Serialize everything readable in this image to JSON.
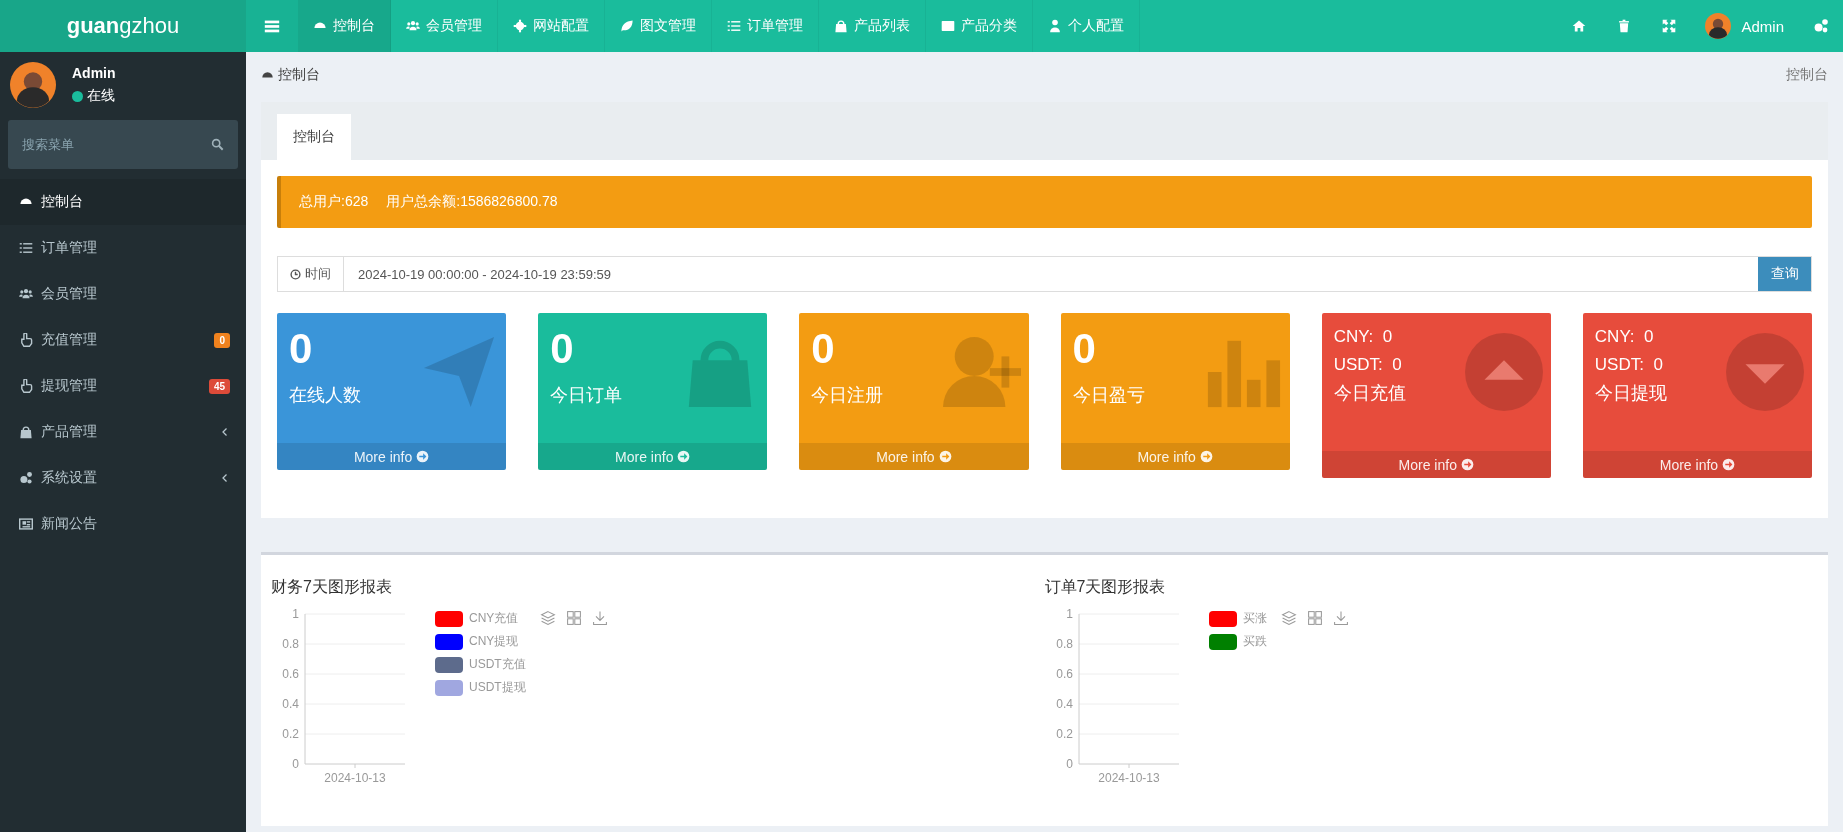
{
  "brand": "**guan**gzhou",
  "topnav": {
    "items": [
      {
        "label": "控制台",
        "selected": true
      },
      {
        "label": "会员管理",
        "selected": false
      },
      {
        "label": "网站配置",
        "selected": false
      },
      {
        "label": "图文管理",
        "selected": false
      },
      {
        "label": "订单管理",
        "selected": false
      },
      {
        "label": "产品列表",
        "selected": false
      },
      {
        "label": "产品分类",
        "selected": false
      },
      {
        "label": "个人配置",
        "selected": false
      }
    ],
    "user": "Admin"
  },
  "user_panel": {
    "name": "Admin",
    "status": "在线"
  },
  "sidebar": {
    "placeholder": "搜索菜单",
    "items": [
      {
        "label": "控制台",
        "selected": true
      },
      {
        "label": "订单管理",
        "selected": false
      },
      {
        "label": "会员管理",
        "selected": false
      },
      {
        "label": "充值管理",
        "selected": false,
        "badge": "0",
        "color": "#f0821e"
      },
      {
        "label": "提现管理",
        "selected": false,
        "badge": "45",
        "color": "#dd4b39"
      },
      {
        "label": "产品管理",
        "selected": false,
        "expanded": false
      },
      {
        "label": "系统设置",
        "selected": false,
        "expanded": false
      },
      {
        "label": "新闻公告",
        "selected": false
      }
    ]
  },
  "breadcrumb": {
    "current": "控制台",
    "right": "控制台"
  },
  "tabs": [
    {
      "label": "控制台",
      "selected": true
    }
  ],
  "alert": [
    "总用户:628",
    "用户总余额:1586826800.78"
  ],
  "date_filter": {
    "label": "时间",
    "value": "2024-10-19 00:00:00 - 2024-10-19 23:59:59",
    "button": "查询"
  },
  "stats": [
    {
      "kind": "count",
      "value": "0",
      "label": "在线人数",
      "color": "#3a95d9",
      "link": "More info"
    },
    {
      "kind": "count",
      "value": "0",
      "label": "今日订单",
      "color": "#1abc9c",
      "link": "More info"
    },
    {
      "kind": "count",
      "value": "0",
      "label": "今日注册",
      "color": "#f39c12",
      "link": "More info"
    },
    {
      "kind": "count",
      "value": "0",
      "label": "今日盈亏",
      "color": "#f39c12",
      "link": "More info"
    },
    {
      "kind": "currency",
      "lines": [
        "CNY:  0",
        "USDT:  0"
      ],
      "label": "今日充值",
      "color": "#e74c3c",
      "link": "More info"
    },
    {
      "kind": "currency",
      "lines": [
        "CNY:  0",
        "USDT:  0"
      ],
      "label": "今日提现",
      "color": "#e74c3c",
      "link": "More info"
    }
  ],
  "charts": [
    {
      "title": "财务7天图形报表",
      "chart_data": {
        "type": "line",
        "grid": true,
        "categories": [
          "2024-10-13"
        ],
        "ylim": [
          0,
          1
        ],
        "yticks": [
          0,
          0.2,
          0.4,
          0.6,
          0.8,
          1
        ],
        "series": [
          {
            "name": "CNY充值",
            "color": "#ff0000",
            "values": [
              null
            ]
          },
          {
            "name": "CNY提现",
            "color": "#0000ff",
            "values": [
              null
            ]
          },
          {
            "name": "USDT充值",
            "color": "#5d6b8c",
            "values": [
              null
            ]
          },
          {
            "name": "USDT提现",
            "color": "#a0a7e0",
            "values": [
              null
            ]
          }
        ]
      }
    },
    {
      "title": "订单7天图形报表",
      "chart_data": {
        "type": "line",
        "grid": true,
        "categories": [
          "2024-10-13"
        ],
        "ylim": [
          0,
          1
        ],
        "yticks": [
          0,
          0.2,
          0.4,
          0.6,
          0.8,
          1
        ],
        "series": [
          {
            "name": "买涨",
            "color": "#ff0000",
            "values": [
              null
            ]
          },
          {
            "name": "买跌",
            "color": "#008000",
            "values": [
              null
            ]
          }
        ]
      }
    }
  ]
}
